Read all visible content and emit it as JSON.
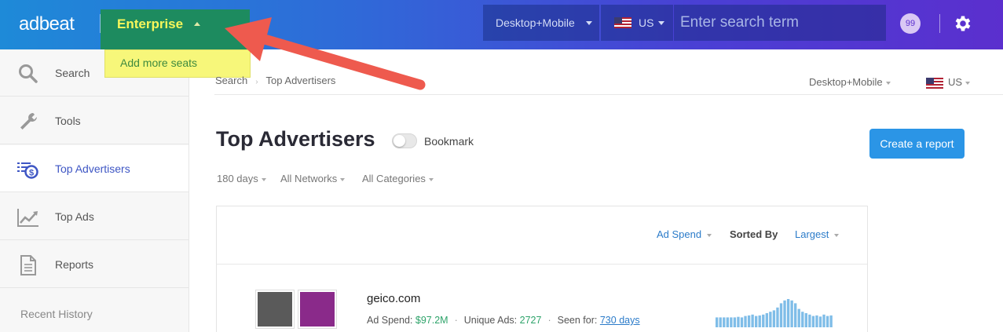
{
  "header": {
    "logo": "adbeat",
    "plan_label": "Enterprise",
    "device_select": "Desktop+Mobile",
    "country_select": "US",
    "search_placeholder": "Enter search term",
    "notification_count": "99",
    "gradient_colors": [
      "#1e8ad8",
      "#5b2fce"
    ]
  },
  "plan_menu": {
    "item": "Add more seats"
  },
  "sidebar": {
    "items": [
      {
        "label": "Search",
        "icon": "search-icon"
      },
      {
        "label": "Tools",
        "icon": "wrench-icon"
      },
      {
        "label": "Top Advertisers",
        "icon": "top-advertisers-icon",
        "active": true
      },
      {
        "label": "Top Ads",
        "icon": "chart-line-icon"
      },
      {
        "label": "Reports",
        "icon": "document-icon"
      }
    ],
    "recent_history": "Recent History"
  },
  "breadcrumb": {
    "root": "Search",
    "current": "Top Advertisers"
  },
  "page_filters": {
    "device": "Desktop+Mobile",
    "country": "US"
  },
  "page": {
    "title": "Top Advertisers",
    "bookmark_label": "Bookmark",
    "create_report": "Create a report",
    "filters": {
      "days": "180 days",
      "networks": "All Networks",
      "categories": "All Categories"
    }
  },
  "sort": {
    "metric": "Ad Spend",
    "sorted_by_label": "Sorted By",
    "order": "Largest"
  },
  "advertisers": [
    {
      "domain": "geico.com",
      "ad_spend_label": "Ad Spend:",
      "ad_spend": "$97.2M",
      "unique_ads_label": "Unique Ads:",
      "unique_ads": "2727",
      "seen_for_label": "Seen for:",
      "seen_for": "730 days",
      "thumb_colors": [
        "#5a5a5a",
        "#8a2a8a"
      ],
      "trend": [
        0.35,
        0.35,
        0.35,
        0.35,
        0.35,
        0.35,
        0.37,
        0.35,
        0.4,
        0.42,
        0.45,
        0.4,
        0.42,
        0.45,
        0.5,
        0.55,
        0.6,
        0.7,
        0.85,
        0.95,
        1.0,
        0.95,
        0.85,
        0.65,
        0.55,
        0.5,
        0.45,
        0.4,
        0.42,
        0.38,
        0.45,
        0.4,
        0.42
      ]
    }
  ],
  "accent_colors": {
    "link": "#2b7bc9",
    "money": "#2ea36a",
    "button": "#2b95e6",
    "annotation_arrow": "#ee5a4e",
    "highlight": "#f7f77a"
  }
}
